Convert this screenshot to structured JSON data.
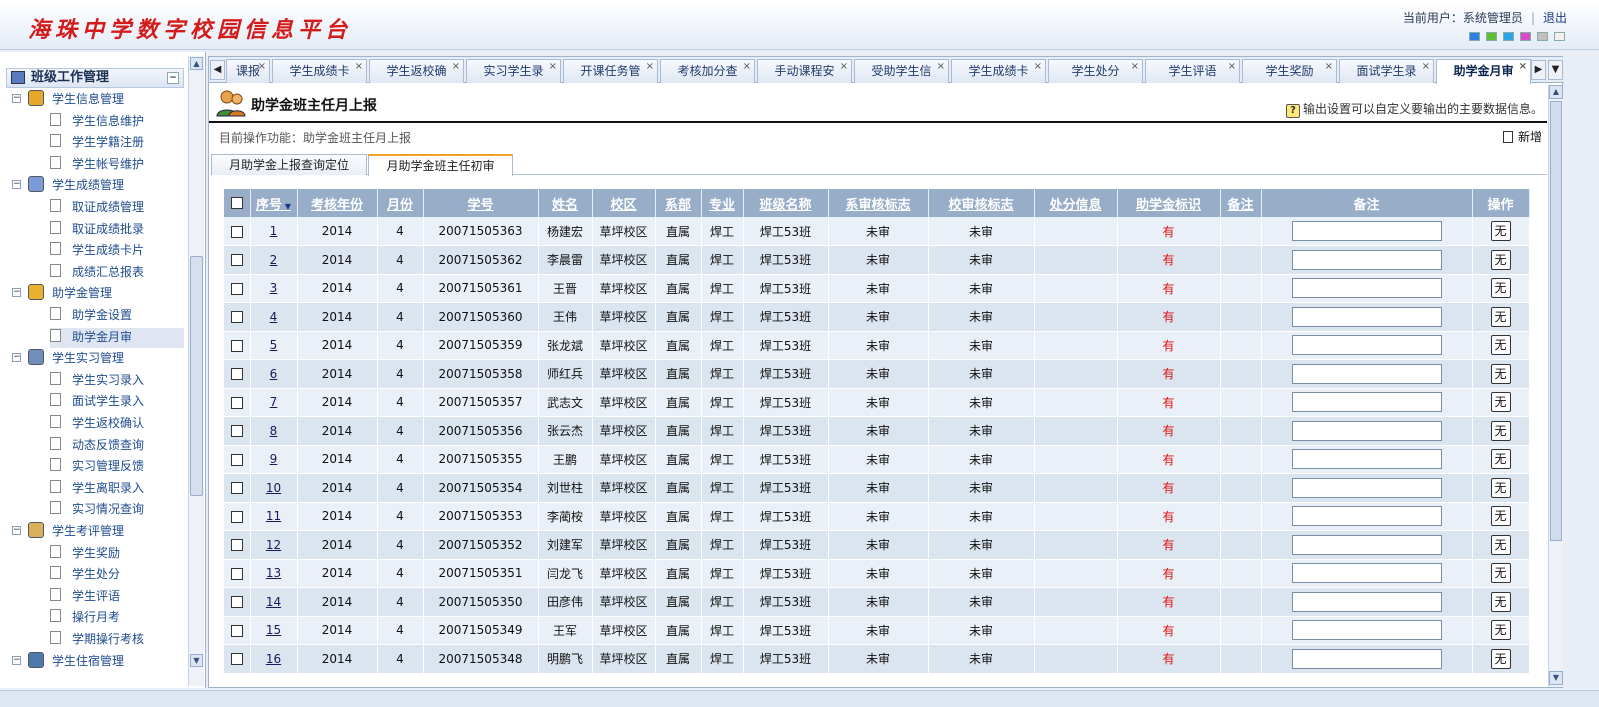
{
  "header": {
    "logo": "海珠中学数字校园信息平台",
    "current_user_label": "当前用户：系统管理员",
    "logout": "退出",
    "swatch_colors": [
      "#2e7de0",
      "#5fbe36",
      "#2aa6e8",
      "#d84cc7",
      "#c0c0c0",
      "#f0f0f0"
    ]
  },
  "sidebar": {
    "top_section": "班级工作管理",
    "groups": [
      {
        "label": "学生信息管理",
        "items": [
          "学生信息维护",
          "学生学籍注册",
          "学生帐号维护"
        ]
      },
      {
        "label": "学生成绩管理",
        "items": [
          "取证成绩管理",
          "取证成绩批录",
          "学生成绩卡片",
          "成绩汇总报表"
        ]
      },
      {
        "label": "助学金管理",
        "items": [
          "助学金设置",
          "助学金月审"
        ]
      },
      {
        "label": "学生实习管理",
        "items": [
          "学生实习录入",
          "面试学生录入",
          "学生返校确认",
          "动态反馈查询",
          "实习管理反馈",
          "学生离职录入",
          "实习情况查询"
        ]
      },
      {
        "label": "学生考评管理",
        "items": [
          "学生奖励",
          "学生处分",
          "学生评语",
          "操行月考",
          "学期操行考核"
        ]
      },
      {
        "label": "学生住宿管理",
        "items": []
      }
    ]
  },
  "tabs": [
    "课报",
    "学生成绩卡",
    "学生返校确",
    "实习学生录",
    "开课任务管",
    "考核加分查",
    "手动课程安",
    "受助学生信",
    "学生成绩卡",
    "学生处分",
    "学生评语",
    "学生奖励",
    "面试学生录",
    "助学金月审"
  ],
  "page": {
    "title": "助学金班主任月上报",
    "hint": "输出设置可以自定义要输出的主要数据信息。",
    "current_op": "目前操作功能：助学金班主任月上报",
    "new_button": "新增",
    "subtabs": [
      "月助学金上报查询定位",
      "月助学金班主任初审"
    ]
  },
  "table": {
    "headers": [
      "序号",
      "考核年份",
      "月份",
      "学号",
      "姓名",
      "校区",
      "系部",
      "专业",
      "班级名称",
      "系审核标志",
      "校审核标志",
      "处分信息",
      "助学金标识",
      "备注",
      "备注",
      "操作"
    ],
    "rows": [
      [
        "1",
        "2014",
        "4",
        "20071505363",
        "杨建宏",
        "草坪校区",
        "直属",
        "焊工",
        "焊工53班",
        "未审",
        "未审",
        "",
        "有",
        "",
        "无"
      ],
      [
        "2",
        "2014",
        "4",
        "20071505362",
        "李晨雷",
        "草坪校区",
        "直属",
        "焊工",
        "焊工53班",
        "未审",
        "未审",
        "",
        "有",
        "",
        "无"
      ],
      [
        "3",
        "2014",
        "4",
        "20071505361",
        "王晋",
        "草坪校区",
        "直属",
        "焊工",
        "焊工53班",
        "未审",
        "未审",
        "",
        "有",
        "",
        "无"
      ],
      [
        "4",
        "2014",
        "4",
        "20071505360",
        "王伟",
        "草坪校区",
        "直属",
        "焊工",
        "焊工53班",
        "未审",
        "未审",
        "",
        "有",
        "",
        "无"
      ],
      [
        "5",
        "2014",
        "4",
        "20071505359",
        "张龙斌",
        "草坪校区",
        "直属",
        "焊工",
        "焊工53班",
        "未审",
        "未审",
        "",
        "有",
        "",
        "无"
      ],
      [
        "6",
        "2014",
        "4",
        "20071505358",
        "师红兵",
        "草坪校区",
        "直属",
        "焊工",
        "焊工53班",
        "未审",
        "未审",
        "",
        "有",
        "",
        "无"
      ],
      [
        "7",
        "2014",
        "4",
        "20071505357",
        "武志文",
        "草坪校区",
        "直属",
        "焊工",
        "焊工53班",
        "未审",
        "未审",
        "",
        "有",
        "",
        "无"
      ],
      [
        "8",
        "2014",
        "4",
        "20071505356",
        "张云杰",
        "草坪校区",
        "直属",
        "焊工",
        "焊工53班",
        "未审",
        "未审",
        "",
        "有",
        "",
        "无"
      ],
      [
        "9",
        "2014",
        "4",
        "20071505355",
        "王鹏",
        "草坪校区",
        "直属",
        "焊工",
        "焊工53班",
        "未审",
        "未审",
        "",
        "有",
        "",
        "无"
      ],
      [
        "10",
        "2014",
        "4",
        "20071505354",
        "刘世柱",
        "草坪校区",
        "直属",
        "焊工",
        "焊工53班",
        "未审",
        "未审",
        "",
        "有",
        "",
        "无"
      ],
      [
        "11",
        "2014",
        "4",
        "20071505353",
        "李蔺桉",
        "草坪校区",
        "直属",
        "焊工",
        "焊工53班",
        "未审",
        "未审",
        "",
        "有",
        "",
        "无"
      ],
      [
        "12",
        "2014",
        "4",
        "20071505352",
        "刘建军",
        "草坪校区",
        "直属",
        "焊工",
        "焊工53班",
        "未审",
        "未审",
        "",
        "有",
        "",
        "无"
      ],
      [
        "13",
        "2014",
        "4",
        "20071505351",
        "闫龙飞",
        "草坪校区",
        "直属",
        "焊工",
        "焊工53班",
        "未审",
        "未审",
        "",
        "有",
        "",
        "无"
      ],
      [
        "14",
        "2014",
        "4",
        "20071505350",
        "田彦伟",
        "草坪校区",
        "直属",
        "焊工",
        "焊工53班",
        "未审",
        "未审",
        "",
        "有",
        "",
        "无"
      ],
      [
        "15",
        "2014",
        "4",
        "20071505349",
        "王军",
        "草坪校区",
        "直属",
        "焊工",
        "焊工53班",
        "未审",
        "未审",
        "",
        "有",
        "",
        "无"
      ],
      [
        "16",
        "2014",
        "4",
        "20071505348",
        "明鹏飞",
        "草坪校区",
        "直属",
        "焊工",
        "焊工53班",
        "未审",
        "未审",
        "",
        "有",
        "",
        "无"
      ]
    ]
  },
  "colors": {
    "header_bg": "#97adc8",
    "row_odd": "#eaf0f7",
    "row_even": "#dbe5f0",
    "logo": "#d41b1b",
    "flag_red": "#e01010"
  }
}
